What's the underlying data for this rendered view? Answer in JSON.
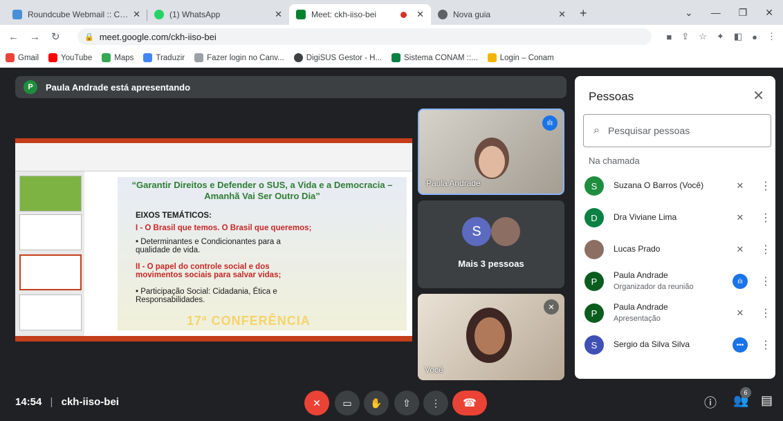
{
  "tabs": [
    {
      "title": "Roundcube Webmail :: Caixa de e",
      "fav_color": "#4a90d9"
    },
    {
      "title": "(1) WhatsApp",
      "fav_color": "#25d366"
    },
    {
      "title": "Meet: ckh-iiso-bei",
      "fav_color": "#00832d"
    },
    {
      "title": "Nova guia",
      "fav_color": "#5f6368"
    }
  ],
  "address": {
    "url": "meet.google.com/ckh-iiso-bei"
  },
  "bookmarks": [
    {
      "label": "Gmail",
      "color": "#ea4335"
    },
    {
      "label": "YouTube",
      "color": "#ff0000"
    },
    {
      "label": "Maps",
      "color": "#34a853"
    },
    {
      "label": "Traduzir",
      "color": "#4285f4"
    },
    {
      "label": "Fazer login no Canv...",
      "color": "#9aa0a6"
    },
    {
      "label": "DigiSUS Gestor - H...",
      "color": "#3c4043"
    },
    {
      "label": "Sistema CONAM ::...",
      "color": "#0b8043"
    },
    {
      "label": "Login – Conam",
      "color": "#f4b400"
    }
  ],
  "meet": {
    "presenter_initial": "P",
    "presenting_text": "Paula Andrade está apresentando",
    "slide": {
      "title": "“Garantir Direitos e Defender o SUS, a Vida e a Democracia – Amanhã Vai Ser Outro Dia”",
      "eixos": "EIXOS TEMÁTICOS:",
      "i": "I - O Brasil que temos. O Brasil que queremos;",
      "b1": "• Determinantes e Condicionantes para a qualidade de vida.",
      "ii": "II - O papel do controle social e dos movimentos sociais para salvar vidas;",
      "b2": "• Participação Social: Cidadania, Ética e Responsabilidades.",
      "conf": "17ª CONFERÊNCIA"
    },
    "tile_paula": "Paula Andrade",
    "tile_more": "Mais 3 pessoas",
    "tile_more_initial": "S",
    "tile_voce": "Você"
  },
  "panel": {
    "title": "Pessoas",
    "search_placeholder": "Pesquisar pessoas",
    "section": "Na chamada",
    "people": [
      {
        "initial": "S",
        "name": "Suzana O Barros (Você)",
        "sub": "",
        "color": "#1e8e3e",
        "status": "mic-off-icon"
      },
      {
        "initial": "D",
        "name": "Dra Viviane Lima",
        "sub": "",
        "color": "#0b8043",
        "status": "mic-off-icon"
      },
      {
        "initial": "",
        "name": "Lucas Prado",
        "sub": "",
        "color": "#8d6e63",
        "status": "mic-off-icon"
      },
      {
        "initial": "P",
        "name": "Paula Andrade",
        "sub": "Organizador da reunião",
        "color": "#0b5d1e",
        "status": "speaking-icon"
      },
      {
        "initial": "P",
        "name": "Paula Andrade",
        "sub": "Apresentação",
        "color": "#0b5d1e",
        "status": "present-muted-icon"
      },
      {
        "initial": "S",
        "name": "Sergio da Silva Silva",
        "sub": "",
        "color": "#3f51b5",
        "status": "more-dots-icon"
      }
    ]
  },
  "bottom": {
    "time": "14:54",
    "meeting_code": "ckh-iiso-bei",
    "people_count": "6"
  }
}
